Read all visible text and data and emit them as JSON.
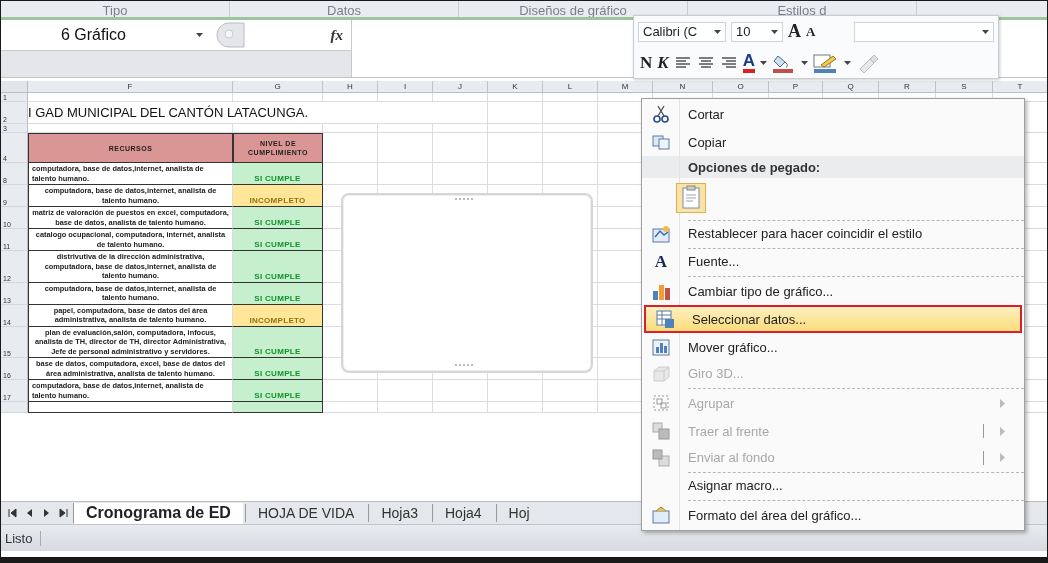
{
  "ribbon_groups": [
    "Tipo",
    "Datos",
    "Diseños de gráfico",
    "Estilos d"
  ],
  "formula_bar": {
    "name_box": "6 Gráfico",
    "fx": "fx"
  },
  "columns": [
    "F",
    "G",
    "H",
    "I",
    "J",
    "K",
    "L",
    "M",
    "N",
    "O",
    "P",
    "Q",
    "R",
    "S",
    "T"
  ],
  "rows": [
    {
      "kind": "blank",
      "row": "1"
    },
    {
      "kind": "title",
      "row": "2",
      "text": "I GAD MUNICIPAL DEL CANTÓN LATACUNGA."
    },
    {
      "kind": "blank",
      "row": "3"
    },
    {
      "kind": "header",
      "row": "4",
      "cells": [
        "RECURSOS",
        "NIVEL DE CUMPLIMIENTO"
      ],
      "color": "#da9694"
    },
    {
      "kind": "data",
      "row": "8",
      "resource": "computadora, base de datos,internet, analista de talento humano.",
      "centered": false,
      "status": "SI CUMPLE",
      "color": "#c6efce"
    },
    {
      "kind": "data",
      "row": "9",
      "resource": "computadora, base de datos,internet, analista de talento humano.",
      "centered": true,
      "status": "INCOMPLETO",
      "color": "#ffe699"
    },
    {
      "kind": "data",
      "row": "10",
      "resource": "matriz de valoración de puestos en excel, computadora, base de datos, analista de talento humano.",
      "centered": true,
      "status": "SI CUMPLE",
      "color": "#c6efce"
    },
    {
      "kind": "data",
      "row": "11",
      "resource": "catalogo ocupacional, computadora, internét, analista de talento humano.",
      "centered": true,
      "status": "SI CUMPLE",
      "color": "#c6efce"
    },
    {
      "kind": "data",
      "row": "12",
      "resource": "distrivutiva de la dirección administrativa, computadora, base de datos,internet, analista de talento humano.",
      "centered": true,
      "status": "SI CUMPLE",
      "color": "#c6efce"
    },
    {
      "kind": "data",
      "row": "13",
      "resource": "computadora, base de datos,internet, analista de talento humano.",
      "centered": true,
      "status": "SI CUMPLE",
      "color": "#c6efce"
    },
    {
      "kind": "data",
      "row": "14",
      "resource": "papel, computadora, base de datos del área administrativa, analista de talento humano.",
      "centered": true,
      "status": "INCOMPLETO",
      "color": "#ffe699"
    },
    {
      "kind": "data",
      "row": "15",
      "resource": "plan de evaluación,salón, computadora, infocus, analista de TH, director de TH, director Administrativa, Jefe de personal administrativo y servidores.",
      "centered": true,
      "status": "SI CUMPLE",
      "color": "#c6efce"
    },
    {
      "kind": "data",
      "row": "16",
      "resource": "base de datos, computadora, excel, base de datos del área administrativa, analista de talento humano.",
      "centered": true,
      "status": "SI CUMPLE",
      "color": "#c6efce"
    },
    {
      "kind": "data",
      "row": "17",
      "resource": "computadora, base de datos,internet, analista de talento humano.",
      "centered": false,
      "status": "SI CUMPLE",
      "color": "#c6efce"
    },
    {
      "kind": "partial",
      "color": "#c6efce"
    }
  ],
  "sheet_tabs": [
    {
      "label": "Cronograma de ED",
      "selected": true
    },
    {
      "label": "HOJA DE VIDA",
      "selected": false
    },
    {
      "label": "Hoja3",
      "selected": false
    },
    {
      "label": "Hoja4",
      "selected": false
    },
    {
      "label": "Hoj",
      "selected": false
    }
  ],
  "status_bar": "Listo",
  "mini_toolbar": {
    "font": "Calibri (C",
    "size": "10",
    "grow": "A",
    "shrink": "A",
    "bold": "N",
    "italic": "K",
    "font_color": "A"
  },
  "context_menu": [
    {
      "kind": "item",
      "label": "Cortar",
      "disabled": false,
      "submenu": false,
      "selected": false,
      "separator_after": false
    },
    {
      "kind": "item",
      "label": "Copiar",
      "disabled": false,
      "submenu": false,
      "selected": false,
      "separator_after": false
    },
    {
      "kind": "header",
      "label": "Opciones de pegado:"
    },
    {
      "kind": "paste",
      "separator_after": true
    },
    {
      "kind": "item",
      "label": "Restablecer para hacer coincidir el estilo",
      "disabled": false,
      "submenu": false,
      "selected": false,
      "separator_after": true
    },
    {
      "kind": "item",
      "label": "Fuente...",
      "glyph": "A",
      "disabled": false,
      "submenu": false,
      "selected": false,
      "separator_after": true
    },
    {
      "kind": "item",
      "label": "Cambiar tipo de gráfico...",
      "disabled": false,
      "submenu": false,
      "selected": false,
      "separator_after": false
    },
    {
      "kind": "item",
      "label": "Seleccionar datos...",
      "disabled": false,
      "submenu": false,
      "selected": true,
      "separator_after": false
    },
    {
      "kind": "item",
      "label": "Mover gráfico...",
      "disabled": false,
      "submenu": false,
      "selected": false,
      "separator_after": false
    },
    {
      "kind": "item",
      "label": "Giro 3D...",
      "disabled": true,
      "submenu": false,
      "selected": false,
      "separator_after": true
    },
    {
      "kind": "item",
      "label": "Agrupar",
      "disabled": true,
      "submenu": true,
      "split": false,
      "selected": false,
      "separator_after": false
    },
    {
      "kind": "item",
      "label": "Traer al frente",
      "disabled": true,
      "submenu": true,
      "split": true,
      "selected": false,
      "separator_after": false
    },
    {
      "kind": "item",
      "label": "Enviar al fondo",
      "disabled": true,
      "submenu": true,
      "split": true,
      "selected": false,
      "separator_after": true
    },
    {
      "kind": "item",
      "label": "Asignar macro...",
      "disabled": false,
      "submenu": false,
      "selected": false,
      "separator_after": true
    },
    {
      "kind": "item",
      "label": "Formato del área del gráfico...",
      "disabled": false,
      "submenu": false,
      "selected": false,
      "separator_after": false
    }
  ]
}
